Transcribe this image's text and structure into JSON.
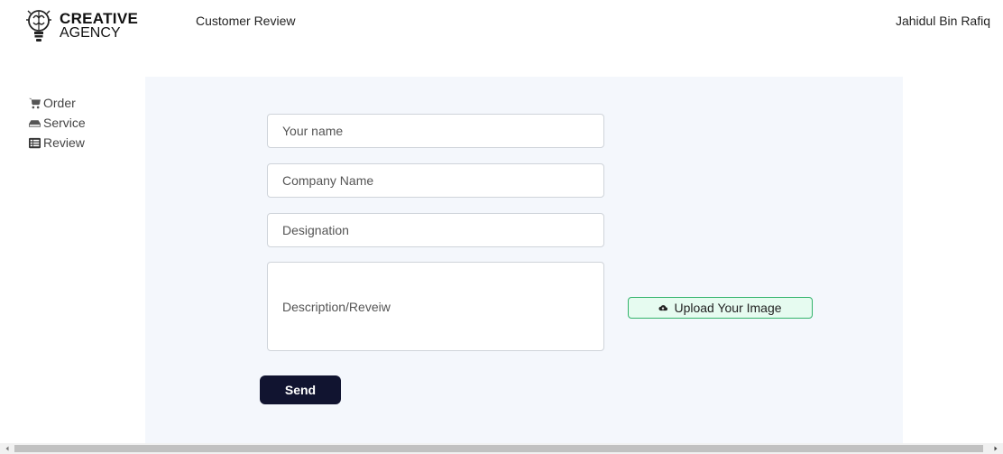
{
  "brand": {
    "line1": "CREATIVE",
    "line2": "AGENCY",
    "logo_icon": "brain-bulb-icon"
  },
  "header": {
    "title": "Customer Review",
    "user_name": "Jahidul Bin Rafiq"
  },
  "sidebar": {
    "items": [
      {
        "label": "Order",
        "icon": "cart-icon"
      },
      {
        "label": "Service",
        "icon": "hdd-icon"
      },
      {
        "label": "Review",
        "icon": "list-icon"
      }
    ]
  },
  "form": {
    "name_placeholder": "Your name",
    "company_placeholder": "Company Name",
    "designation_placeholder": "Designation",
    "description_placeholder": "Description/Reveiw",
    "upload_label": "Upload Your Image",
    "send_label": "Send"
  },
  "colors": {
    "main_bg": "#f4f7fc",
    "send_bg": "#111430",
    "upload_bg": "#e6fbf0",
    "upload_border": "#33b36b"
  }
}
